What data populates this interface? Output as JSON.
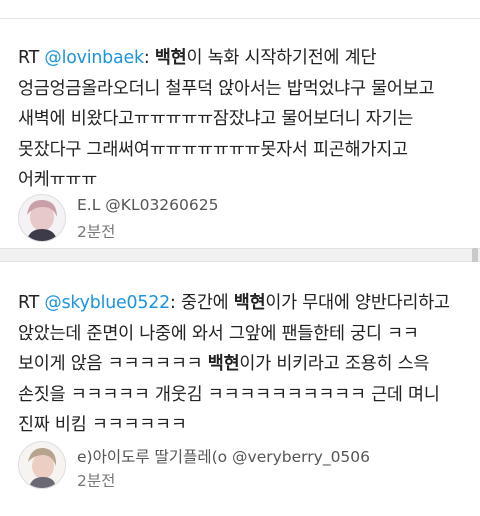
{
  "tweets": [
    {
      "prefix": "RT ",
      "mention": "@lovinbaek",
      "colon": ": ",
      "highlight": "백현",
      "text": "이 녹화 시작하기전에 계단 엉금엉금올라오더니 철푸덕 앉아서는 밥먹었냐구 물어보고 새벽에 비왔다고ㅠㅠㅠㅠㅠ잠잤냐고 물어보더니 자기는 못잤다구 그래써여ㅠㅠㅠㅠㅠㅠㅠ못자서 피곤해가지고 어케ㅠㅠㅠ",
      "author": "E.L @KL03260625",
      "time": "2분전"
    },
    {
      "prefix": "RT ",
      "mention": "@skyblue0522",
      "colon": ": ",
      "text_a": "중간에 ",
      "highlight": "백현",
      "text_b": "이가 무대에 양반다리하고 앉았는데 준면이 나중에 와서 그앞에 팬들한테 궁디 ㅋㅋ 보이게 앉음 ㅋㅋㅋㅋㅋㅋ ",
      "highlight2": "백현",
      "text_c": "이가 비키라고 조용히 스윽 손짓을 ㅋㅋㅋㅋㅋ 개웃김 ㅋㅋㅋㅋㅋㅋㅋㅋㅋㅋ 근데 며니 진짜 비킴 ㅋㅋㅋㅋㅋㅋ",
      "author": "e)아이도루 딸기플레(o @veryberry_0506",
      "time": "2분전"
    }
  ]
}
